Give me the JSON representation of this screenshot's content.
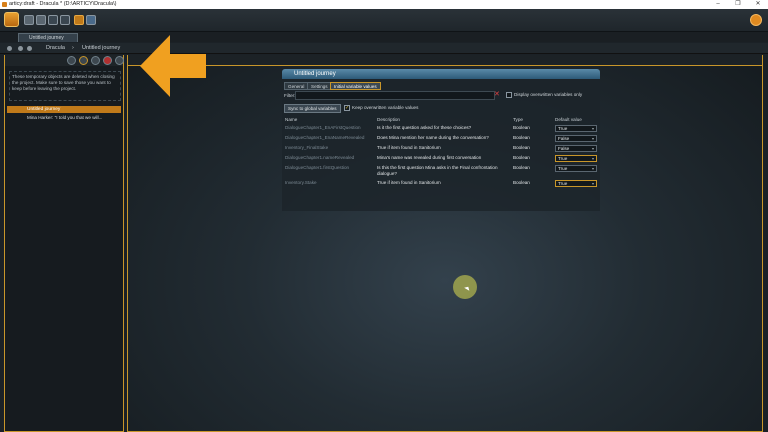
{
  "window": {
    "title": "articy:draft - Dracula * (D:\\ARTICY\\Dracula\\)",
    "minimize": "–",
    "maximize": "❐",
    "close": "✕"
  },
  "tabs": {
    "document_tab": "Untitled journey"
  },
  "breadcrumb": {
    "root": "Dracula",
    "separator": "›",
    "current": "Untitled journey"
  },
  "left_panel": {
    "note": "These temporary objects are deleted when closing the project. Make sure to save those you want to keep before leaving the project.",
    "tree": [
      {
        "label": "Untitled journey"
      },
      {
        "label": "Mina Harker: \"I told you that we will..."
      }
    ]
  },
  "panel": {
    "title": "Untitled journey",
    "tabs": [
      "General",
      "Settings",
      "Initial variable values"
    ],
    "active_tab": 2,
    "filter_label": "Filter:",
    "filter_value": "",
    "display_overwritten_label": "Display overwritten variables only",
    "sync_button": "Sync to global variables",
    "keep_overwritten_label": "Keep overwritten variable values",
    "keep_overwritten_checked": true
  },
  "table": {
    "headers": [
      "Name",
      "Description",
      "Type",
      "Default value"
    ],
    "rows": [
      {
        "name": "DialogueChapter1_EnAFirstQuestion",
        "description": "Is it the first question asked for these choices?",
        "type": "Boolean",
        "value": "True",
        "highlight": false
      },
      {
        "name": "DialogueChapter1_EnaNameRevealed",
        "description": "Does Mina mention her name during the conversation?",
        "type": "Boolean",
        "value": "False",
        "highlight": false
      },
      {
        "name": "Inventory_FinalStake",
        "description": "True if item found in Sanitorium",
        "type": "Boolean",
        "value": "False",
        "highlight": false
      },
      {
        "name": "DialogueChapter1.nameRevealed",
        "description": "Mina's name was revealed during first conversation",
        "type": "Boolean",
        "value": "True",
        "highlight": true
      },
      {
        "name": "DialogueChapter1.firstQuestion",
        "description": "Is this the first question Mina asks in the Final confrontation dialogue?",
        "type": "Boolean",
        "value": "True",
        "highlight": false
      },
      {
        "name": "Inventory.Stake",
        "description": "True if item found in Sanitorium",
        "type": "Boolean",
        "value": "True",
        "highlight": true
      }
    ]
  },
  "icons": {
    "accent": "#c8962a",
    "arrow": "#f0a020"
  }
}
